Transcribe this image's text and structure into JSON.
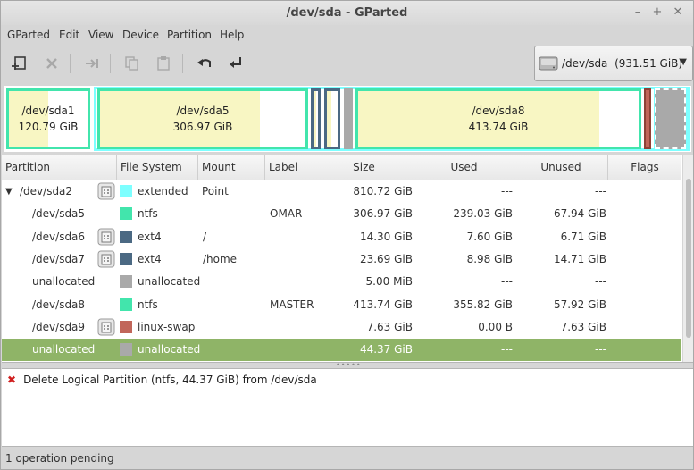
{
  "window": {
    "title": "/dev/sda - GParted"
  },
  "menu": [
    "GParted",
    "Edit",
    "View",
    "Device",
    "Partition",
    "Help"
  ],
  "toolbar": {
    "icons": [
      "new-partition-icon",
      "delete-icon",
      "resize-move-icon",
      "copy-icon",
      "paste-icon",
      "undo-icon",
      "apply-icon"
    ]
  },
  "device_selector": {
    "device": "/dev/sda",
    "size": "(931.51 GiB)"
  },
  "partition_map": {
    "sda1": {
      "name": "/dev/sda1",
      "size": "120.79 GiB",
      "used_fraction": 0.5
    },
    "sda5": {
      "name": "/dev/sda5",
      "size": "306.97 GiB",
      "used_fraction": 0.78
    },
    "sda8": {
      "name": "/dev/sda8",
      "size": "413.74 GiB",
      "used_fraction": 0.86
    }
  },
  "columns": [
    "Partition",
    "File System",
    "Mount Point",
    "Label",
    "Size",
    "Used",
    "Unused",
    "Flags"
  ],
  "rows": [
    {
      "partition": "/dev/sda2",
      "fs": "extended",
      "fs_color": "#7dffff",
      "mount": "",
      "label": "",
      "size": "810.72 GiB",
      "used": "---",
      "unused": "---",
      "flags": "",
      "locked": true,
      "expander": true
    },
    {
      "partition": "/dev/sda5",
      "fs": "ntfs",
      "fs_color": "#42e5ac",
      "mount": "",
      "label": "OMAR",
      "size": "306.97 GiB",
      "used": "239.03 GiB",
      "unused": "67.94 GiB",
      "flags": "",
      "locked": false
    },
    {
      "partition": "/dev/sda6",
      "fs": "ext4",
      "fs_color": "#4b6983",
      "mount": "/",
      "label": "",
      "size": "14.30 GiB",
      "used": "7.60 GiB",
      "unused": "6.71 GiB",
      "flags": "",
      "locked": true
    },
    {
      "partition": "/dev/sda7",
      "fs": "ext4",
      "fs_color": "#4b6983",
      "mount": "/home",
      "label": "",
      "size": "23.69 GiB",
      "used": "8.98 GiB",
      "unused": "14.71 GiB",
      "flags": "",
      "locked": true
    },
    {
      "partition": "unallocated",
      "fs": "unallocated",
      "fs_color": "#a9a9a9",
      "mount": "",
      "label": "",
      "size": "5.00 MiB",
      "used": "---",
      "unused": "---",
      "flags": "",
      "locked": false
    },
    {
      "partition": "/dev/sda8",
      "fs": "ntfs",
      "fs_color": "#42e5ac",
      "mount": "",
      "label": "MASTER",
      "size": "413.74 GiB",
      "used": "355.82 GiB",
      "unused": "57.92 GiB",
      "flags": "",
      "locked": false
    },
    {
      "partition": "/dev/sda9",
      "fs": "linux-swap",
      "fs_color": "#c1665a",
      "mount": "",
      "label": "",
      "size": "7.63 GiB",
      "used": "0.00 B",
      "unused": "7.63 GiB",
      "flags": "",
      "locked": true
    },
    {
      "partition": "unallocated",
      "fs": "unallocated",
      "fs_color": "#a9a9a9",
      "mount": "",
      "label": "",
      "size": "44.37 GiB",
      "used": "---",
      "unused": "---",
      "flags": "",
      "locked": false,
      "selected": true
    }
  ],
  "operations": [
    "Delete Logical Partition (ntfs, 44.37 GiB) from /dev/sda"
  ],
  "status": "1 operation pending",
  "colors": {
    "selection": "#8fb467",
    "extended_border": "#7dffff",
    "ntfs_border": "#42e5ac"
  }
}
